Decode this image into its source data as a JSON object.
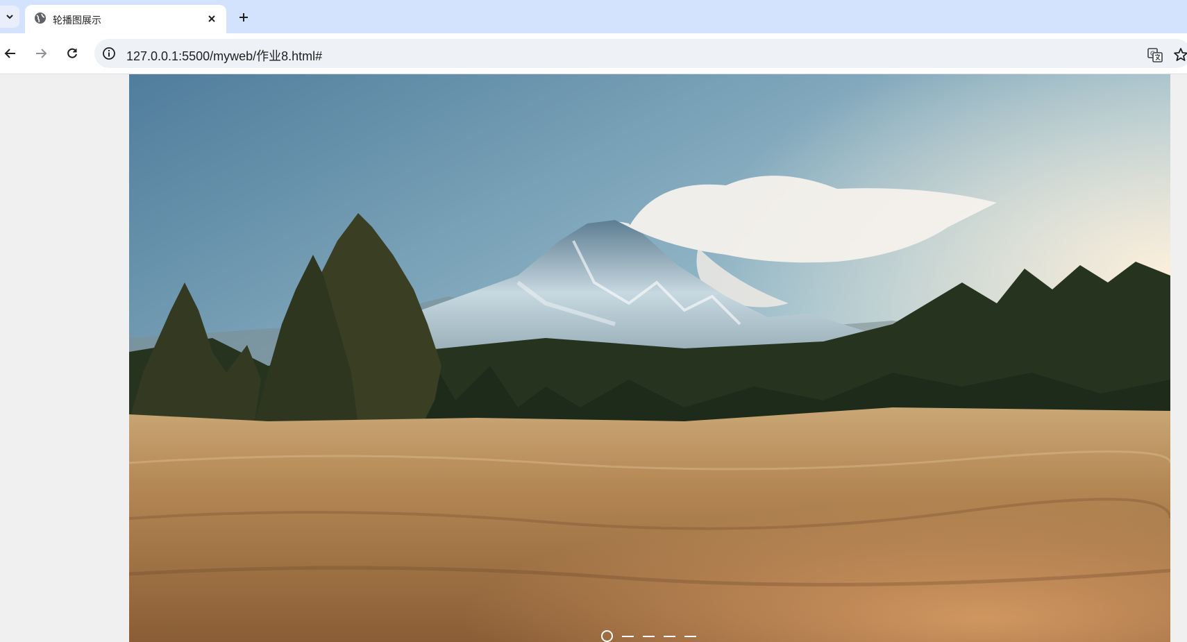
{
  "browser": {
    "tab": {
      "title": "轮播图展示"
    },
    "address_bar": {
      "url": "127.0.0.1:5500/myweb/作业8.html#"
    },
    "icons": {
      "tab_dropdown": "chevron-down-icon",
      "favicon": "globe-icon",
      "tab_close": "close-icon",
      "new_tab": "plus-icon",
      "back": "arrow-left-icon",
      "forward": "arrow-right-icon",
      "reload": "reload-icon",
      "site_info": "info-icon",
      "translate": "translate-icon",
      "bookmark": "star-icon"
    }
  },
  "carousel": {
    "slide_count": 5,
    "active_index": 0,
    "slide_description_colors": {
      "sky_top": "#5f8aa8",
      "sky_bottom": "#b9d2dc",
      "field": "#b88a55",
      "forest": "#2c3a28"
    }
  }
}
